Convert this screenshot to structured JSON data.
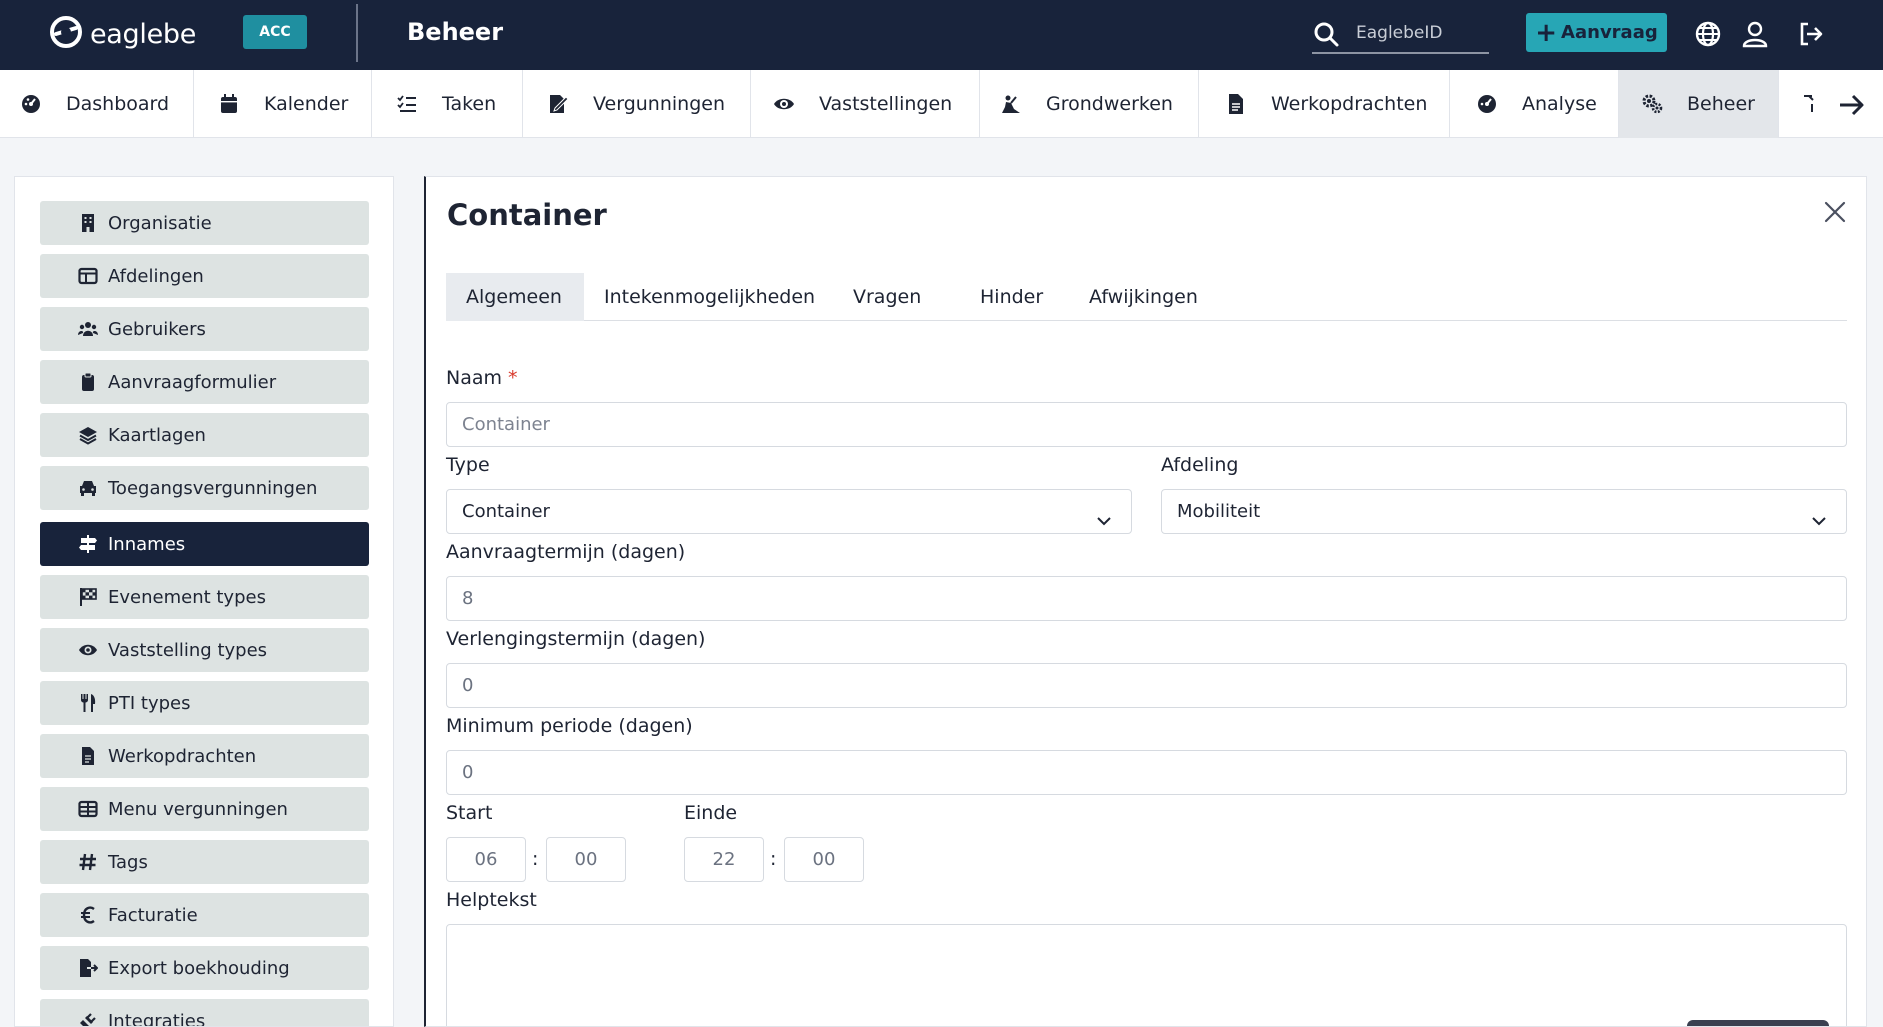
{
  "header": {
    "logo_text": "eaglebe",
    "env_badge": "ACC",
    "title": "Beheer",
    "search_placeholder": "EaglebeID",
    "new_request_label": "Aanvraag",
    "icons": [
      "search-icon",
      "plus-icon",
      "globe-icon",
      "user-icon",
      "logout-icon"
    ]
  },
  "modules": [
    {
      "label": "Dashboard",
      "icon": "dashboard-icon"
    },
    {
      "label": "Kalender",
      "icon": "calendar-icon"
    },
    {
      "label": "Taken",
      "icon": "tasks-icon"
    },
    {
      "label": "Vergunningen",
      "icon": "permit-icon"
    },
    {
      "label": "Vaststellingen",
      "icon": "eye-icon"
    },
    {
      "label": "Grondwerken",
      "icon": "excavation-icon"
    },
    {
      "label": "Werkopdrachten",
      "icon": "document-icon"
    },
    {
      "label": "Analyse",
      "icon": "analyse-icon"
    },
    {
      "label": "Beheer",
      "icon": "cogs-icon",
      "active": true
    }
  ],
  "sidebar": {
    "items": [
      {
        "label": "Organisatie",
        "icon": "building-icon"
      },
      {
        "label": "Afdelingen",
        "icon": "table-icon"
      },
      {
        "label": "Gebruikers",
        "icon": "users-icon"
      },
      {
        "label": "Aanvraagformulier",
        "icon": "clipboard-icon"
      },
      {
        "label": "Kaartlagen",
        "icon": "layers-icon"
      },
      {
        "label": "Toegangsvergunningen",
        "icon": "car-icon"
      },
      {
        "label": "Innames",
        "icon": "signpost-icon",
        "active": true
      },
      {
        "label": "Evenement types",
        "icon": "flag-checkered-icon"
      },
      {
        "label": "Vaststelling types",
        "icon": "eye-icon"
      },
      {
        "label": "PTI types",
        "icon": "utensils-icon"
      },
      {
        "label": "Werkopdrachten",
        "icon": "document-icon"
      },
      {
        "label": "Menu vergunningen",
        "icon": "table-icon"
      },
      {
        "label": "Tags",
        "icon": "hashtag-icon"
      },
      {
        "label": "Facturatie",
        "icon": "euro-icon"
      },
      {
        "label": "Export boekhouding",
        "icon": "file-export-icon"
      },
      {
        "label": "Integraties",
        "icon": "plug-icon"
      }
    ]
  },
  "panel": {
    "title": "Container",
    "tabs": [
      {
        "label": "Algemeen",
        "active": true
      },
      {
        "label": "Intekenmogelijkheden"
      },
      {
        "label": "Vragen"
      },
      {
        "label": "Hinder"
      },
      {
        "label": "Afwijkingen"
      }
    ],
    "form": {
      "naam_label": "Naam",
      "naam_required": "*",
      "naam_placeholder": "Container",
      "type_label": "Type",
      "type_value": "Container",
      "afdeling_label": "Afdeling",
      "afdeling_value": "Mobiliteit",
      "aanvraagtermijn_label": "Aanvraagtermijn (dagen)",
      "aanvraagtermijn_value": "8",
      "verlengingstermijn_label": "Verlengingstermijn (dagen)",
      "verlengingstermijn_value": "0",
      "minimum_label": "Minimum periode (dagen)",
      "minimum_value": "0",
      "start_label": "Start",
      "start_hour": "06",
      "start_minute": "00",
      "einde_label": "Einde",
      "einde_hour": "22",
      "einde_minute": "00",
      "time_separator": ":",
      "helptekst_label": "Helptekst"
    }
  },
  "colors": {
    "topbar": "#18233b",
    "accent": "#27a6b5",
    "badge": "#1f8fa0",
    "sidebar_item": "#dde3e2",
    "sidebar_active": "#18233b",
    "required": "#d8392b"
  }
}
